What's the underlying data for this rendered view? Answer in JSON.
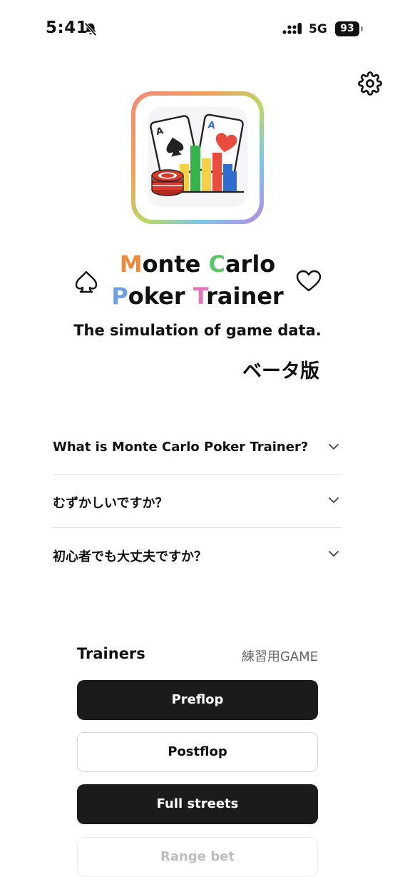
{
  "status_bar": {
    "time": "5:41",
    "network": "5G",
    "battery": "93"
  },
  "icons": {
    "mute": "bell-slash-icon",
    "signal": "signal-bars-icon",
    "battery": "battery-icon",
    "settings": "gear-icon",
    "logo": "app-logo-cards-chart",
    "spade": "spade-outline-icon",
    "heart": "heart-outline-icon",
    "chevron": "chevron-down-icon"
  },
  "header": {
    "logo_card_left": "A",
    "logo_card_right": "A",
    "title_line1": {
      "letter1": "M",
      "rest1": "onte ",
      "letter2": "C",
      "rest2": "arlo"
    },
    "title_line2": {
      "letter1": "P",
      "rest1": "oker ",
      "letter2": "T",
      "rest2": "rainer"
    },
    "subtitle": "The simulation of game data.",
    "beta": "ベータ版"
  },
  "colors": {
    "M": "#EF8A3B",
    "C": "#5DC56B",
    "P": "#6FA0E6",
    "T": "#E176B8",
    "dark_button": "#1b1b1b"
  },
  "faq": {
    "items": [
      {
        "question": "What is Monte Carlo Poker Trainer?"
      },
      {
        "question": "むずかしいですか？"
      },
      {
        "question": "初心者でも大丈夫ですか？"
      }
    ]
  },
  "trainers": {
    "title": "Trainers",
    "subtitle": "練習用GAME",
    "buttons": [
      {
        "label": "Preflop",
        "style": "dark"
      },
      {
        "label": "Postflop",
        "style": "light"
      },
      {
        "label": "Full streets",
        "style": "dark"
      },
      {
        "label": "Range bet",
        "style": "faded"
      }
    ]
  }
}
